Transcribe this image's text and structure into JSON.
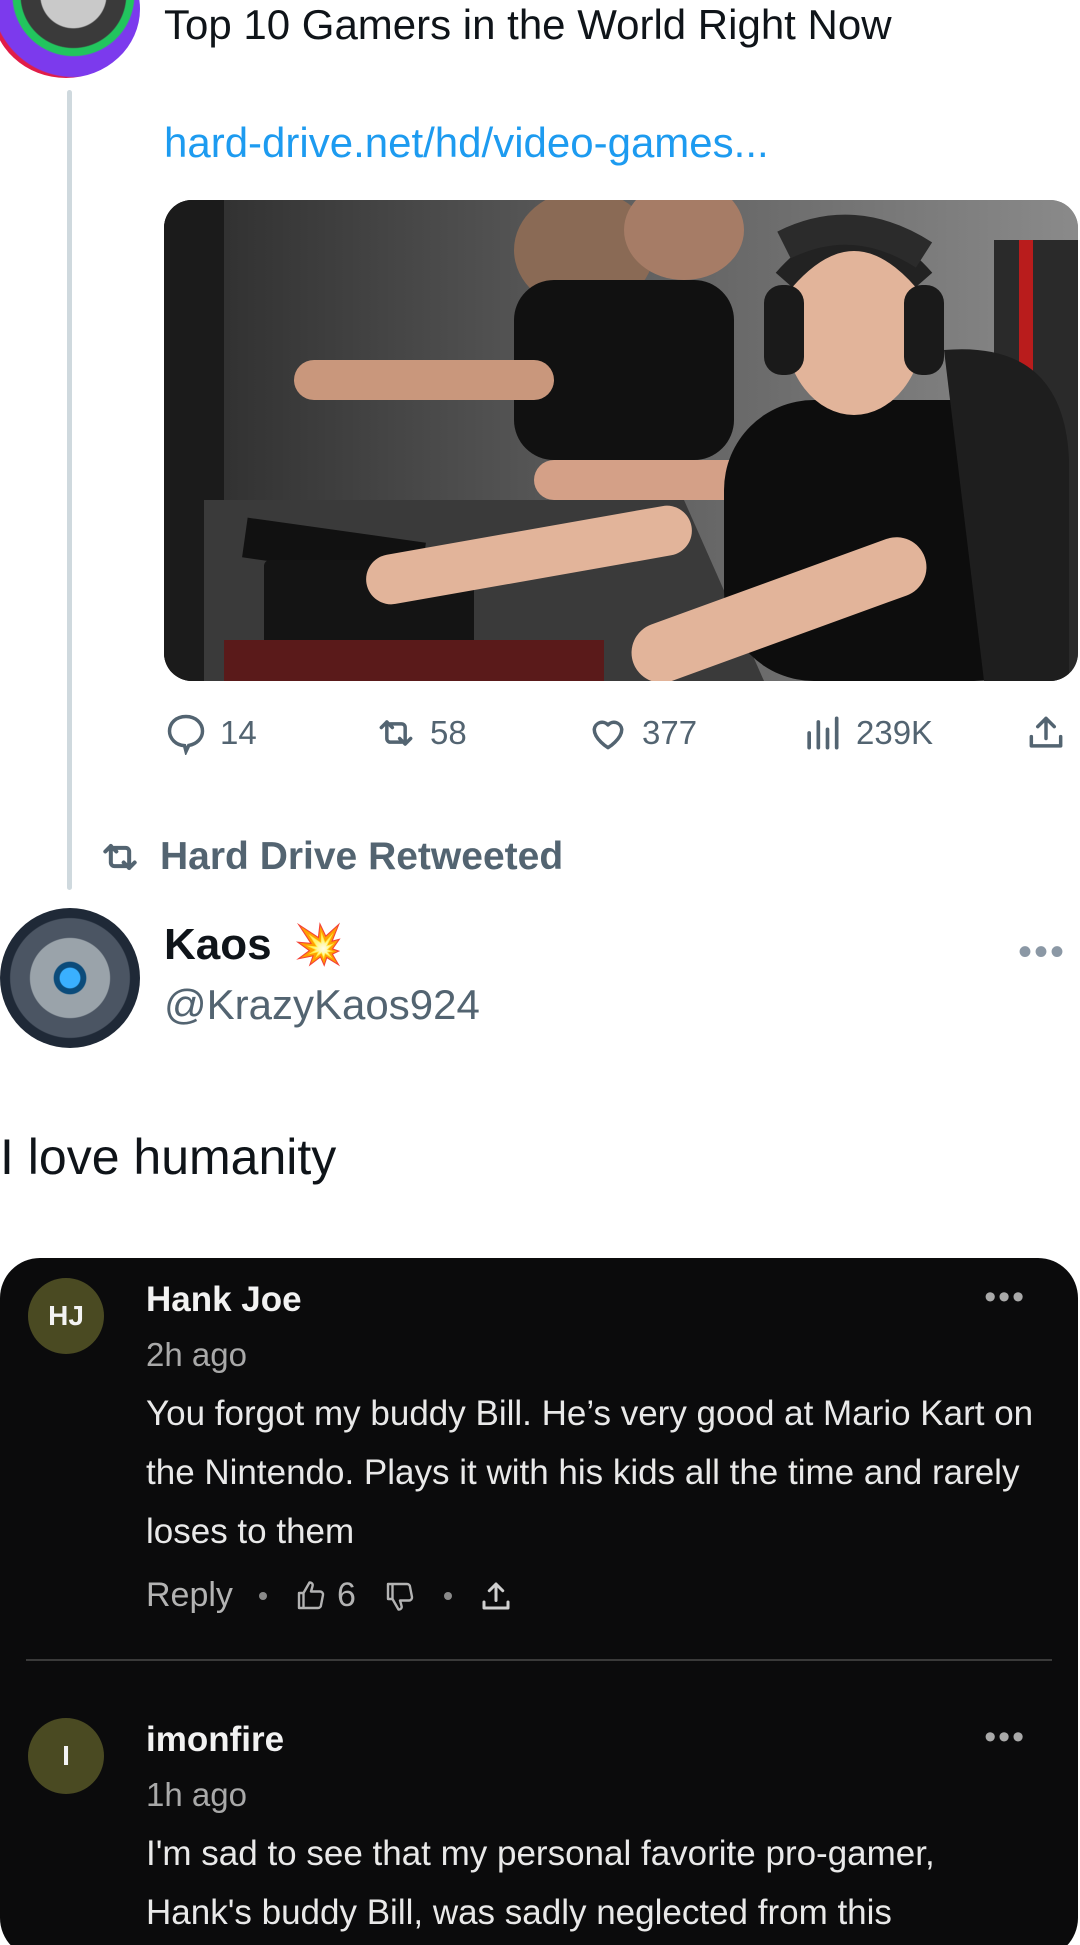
{
  "post": {
    "title": "Top 10 Gamers in the World Right Now",
    "link": "hard-drive.net/hd/video-games...",
    "stats": {
      "replies": "14",
      "retweets": "58",
      "likes": "377",
      "views": "239K"
    }
  },
  "retweet_banner": {
    "text": "Hard Drive Retweeted"
  },
  "tweet": {
    "name": "Kaos",
    "badge_emoji": "💥",
    "handle": "@KrazyKaos924",
    "text": "I love humanity",
    "more_glyph": "•••"
  },
  "comments": [
    {
      "initials": "HJ",
      "name": "Hank Joe",
      "time": "2h ago",
      "body": "You forgot my buddy Bill. He’s very good at Mario Kart on the Nintendo. Plays it with his kids all the time and rarely loses to them",
      "reply_label": "Reply",
      "upvotes": "6",
      "more_glyph": "•••"
    },
    {
      "initials": "I",
      "name": "imonfire",
      "time": "1h ago",
      "body": "I'm sad to see that my personal favorite pro-gamer, Hank's buddy Bill, was sadly neglected from this",
      "more_glyph": "•••"
    }
  ],
  "icons": {
    "reply": "speech-bubble-icon",
    "retweet": "retweet-arrows-icon",
    "like": "heart-icon",
    "views": "bar-chart-icon",
    "share": "share-upload-icon"
  },
  "colors": {
    "link": "#1d9bf0",
    "muted": "#536471",
    "card_bg": "#0b0b0c",
    "avatar_bg": "#4a4a22"
  }
}
